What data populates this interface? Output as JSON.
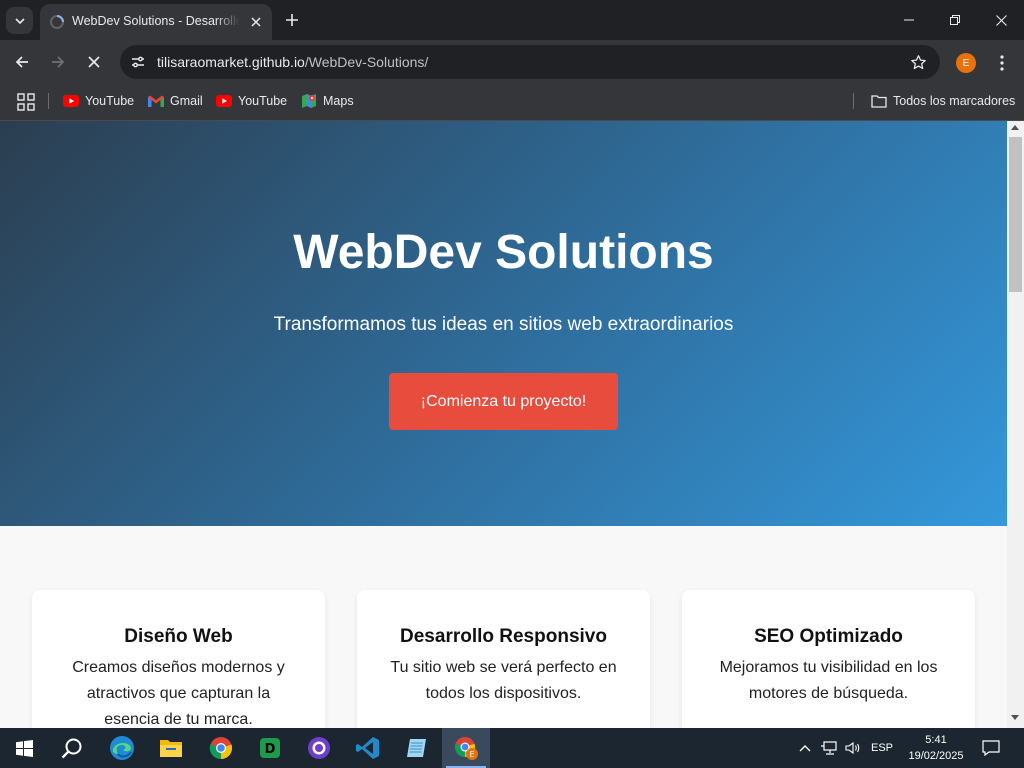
{
  "browser": {
    "tab": {
      "title": "WebDev Solutions - Desarrollo Web"
    },
    "url": {
      "host": "tilisaraomarket.github.io",
      "path": "/WebDev-Solutions/"
    },
    "avatar_letter": "E",
    "bookmarks": [
      {
        "label": "YouTube",
        "icon": "youtube-icon"
      },
      {
        "label": "Gmail",
        "icon": "gmail-icon"
      },
      {
        "label": "YouTube",
        "icon": "youtube-icon"
      },
      {
        "label": "Maps",
        "icon": "maps-icon"
      }
    ],
    "all_bookmarks_label": "Todos los marcadores"
  },
  "page": {
    "hero": {
      "title": "WebDev Solutions",
      "subtitle": "Transformamos tus ideas en sitios web extraordinarios",
      "cta_label": "¡Comienza tu proyecto!"
    },
    "services": [
      {
        "title": "Diseño Web",
        "text": "Creamos diseños modernos y atractivos que capturan la esencia de tu marca."
      },
      {
        "title": "Desarrollo Responsivo",
        "text": "Tu sitio web se verá perfecto en todos los dispositivos."
      },
      {
        "title": "SEO Optimizado",
        "text": "Mejoramos tu visibilidad en los motores de búsqueda."
      }
    ],
    "colors": {
      "hero_start": "#2c3e50",
      "hero_end": "#3498db",
      "cta": "#e74c3c"
    }
  },
  "taskbar": {
    "apps": [
      "start-icon",
      "search-icon",
      "edge-icon",
      "file-explorer-icon",
      "chrome-icon",
      "dbeaver-icon",
      "github-desktop-icon",
      "vscode-icon",
      "notepad-icon",
      "chrome-profile-icon"
    ],
    "language": "ESP",
    "time": "5:41",
    "date": "19/02/2025"
  }
}
